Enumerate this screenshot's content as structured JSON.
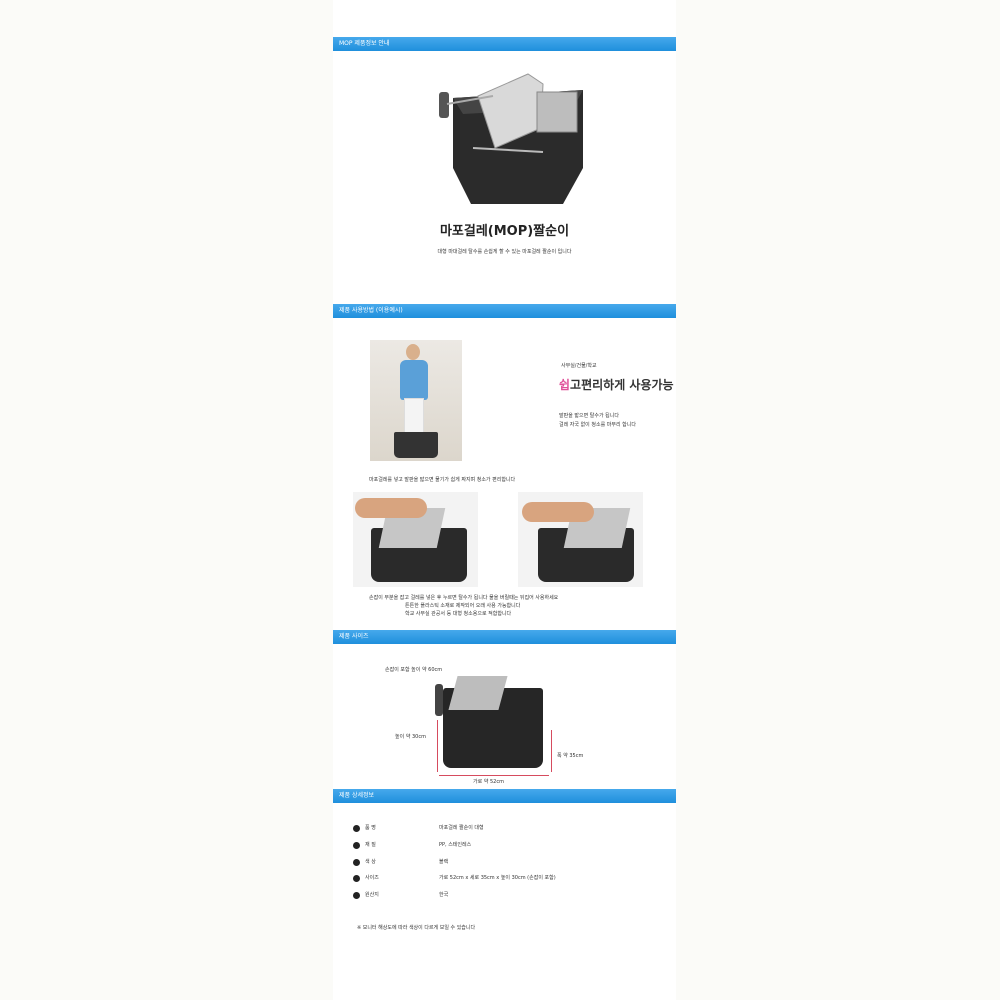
{
  "sections": {
    "intro": {
      "header": "MOP 제품정보 안내",
      "title": "마포걸레(MOP)짤순이",
      "subtitle": "대형 마대걸레 탈수를 손쉽게 할 수 있는 마포걸레 짤순이 입니다"
    },
    "usage": {
      "header": "제품 사용방법 (이용예시)",
      "tag_small": "사무실/건물/학교",
      "tag_big_pink": "쉽",
      "tag_big_rest": "고편리하게 사용가능",
      "desc1": "발판을 밟으면 탈수가 됩니다",
      "desc2": "걸레 자국 없이 청소를 마무리 합니다",
      "caption1": "마포걸레를 넣고 발판을 밟으면 물기가 쉽게 짜지며 청소가 편리합니다",
      "caption2": "손잡이 부분을 잡고 걸레를 넣은 후 누르면 탈수가 됩니다 물을 버릴때는 뒤집어 사용하세요",
      "caption3": "튼튼한 플라스틱 소재로 제작되어 오래 사용 가능합니다",
      "caption4": "학교 사무실 관공서 등 대형 청소용으로 적합합니다"
    },
    "size": {
      "header": "제품 사이즈",
      "label_top": "손잡이 포함 높이 약 60cm",
      "label_height": "높이 약 30cm",
      "label_depth": "폭 약 35cm",
      "label_width": "가로 약 52cm"
    },
    "spec": {
      "header": "제품 상세정보",
      "rows": [
        {
          "label": "품 명",
          "value": "마포걸레 짤순이 대형"
        },
        {
          "label": "재 질",
          "value": "PP, 스테인레스"
        },
        {
          "label": "색 상",
          "value": "블랙"
        },
        {
          "label": "사이즈",
          "value": "가로 52cm x 세로 35cm x 높이 30cm (손잡이 포함)"
        },
        {
          "label": "원산지",
          "value": "한국"
        }
      ],
      "footnote": "※ 모니터 해상도에 따라 색상이 다르게 보일 수 있습니다"
    }
  },
  "colors": {
    "band": "#1f8fdc",
    "accent_pink": "#e0529a",
    "dim_line": "#d64b5e"
  }
}
